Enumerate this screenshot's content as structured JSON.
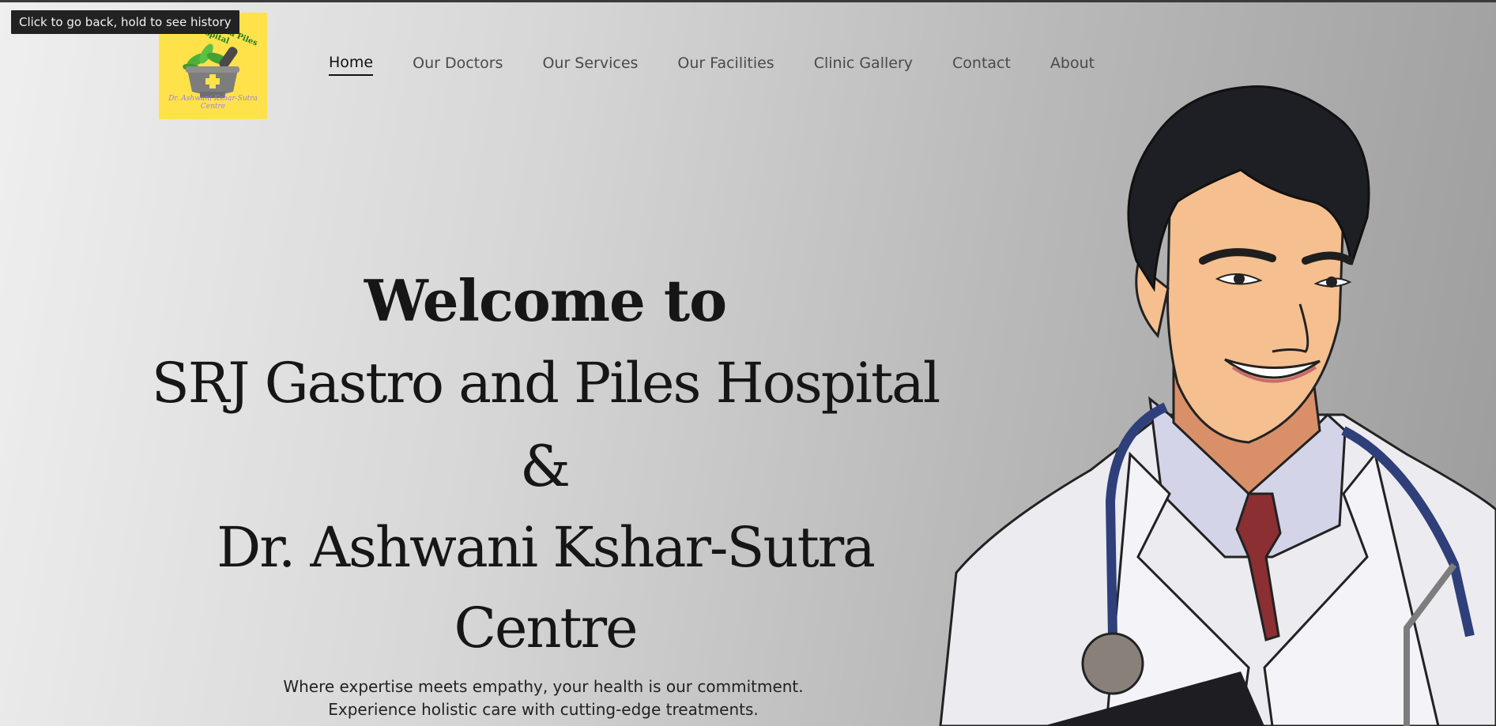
{
  "browser": {
    "tooltip": "Click to go back, hold to see history"
  },
  "logo": {
    "top_text": "SRJ Gastro and Piles Hospital",
    "bottom_text": "Dr. Ashwani Kshar-Sutra Centre",
    "background_color": "#ffe24a"
  },
  "nav": {
    "items": [
      {
        "label": "Home",
        "active": true
      },
      {
        "label": "Our Doctors",
        "active": false
      },
      {
        "label": "Our Services",
        "active": false
      },
      {
        "label": "Our Facilities",
        "active": false
      },
      {
        "label": "Clinic Gallery",
        "active": false
      },
      {
        "label": "Contact",
        "active": false
      },
      {
        "label": "About",
        "active": false
      }
    ]
  },
  "hero": {
    "line1": "Welcome to",
    "line2": "SRJ Gastro and Piles Hospital",
    "line3": "&",
    "line4": "Dr. Ashwani Kshar-Sutra Centre"
  },
  "tagline": {
    "line1": "Where expertise meets empathy, your health is our commitment.",
    "line2": "Experience holistic care with cutting-edge treatments."
  },
  "illustration": {
    "subject": "doctor-illustration"
  }
}
